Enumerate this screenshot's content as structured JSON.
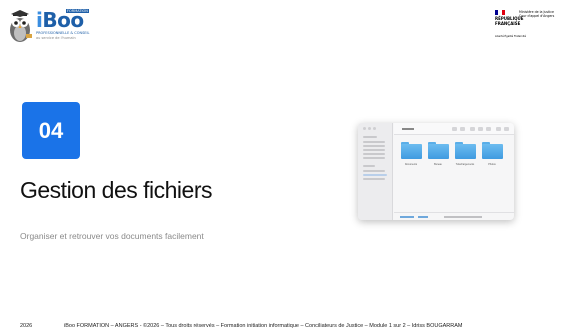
{
  "logo": {
    "wordmark_i": "i",
    "wordmark_rest": "Boo",
    "tag": "FORMATION",
    "sub1": "PROFESSIONNELLE & CONSEIL",
    "sub2": "au service de l'humain"
  },
  "gov": {
    "republic": "RÉPUBLIQUE\nFRANÇAISE",
    "motto": "Liberté Égalité Fraternité",
    "ministry": "Ministère de la Justice\nCour d'appel d'Angers",
    "flag_colors": [
      "#000091",
      "#ffffff",
      "#e1000f"
    ]
  },
  "slide": {
    "number": "04",
    "title": "Gestion des fichiers",
    "subtitle": "Organiser et retrouver vos documents facilement"
  },
  "finder": {
    "window_title": "Dossiers",
    "folders": [
      "Documents",
      "Bureau",
      "Téléchargements",
      "Photos"
    ]
  },
  "footer": {
    "year": "2026",
    "text": "iBoo FORMATION – ANGERS - ©2026 – Tous droits réservés – Formation initiation informatique – Conciliateurs de Justice – Module 1 sur 2 – Idriss BOUGARRAM"
  },
  "colors": {
    "accent": "#1a73e8",
    "brand": "#1e5fa8"
  }
}
